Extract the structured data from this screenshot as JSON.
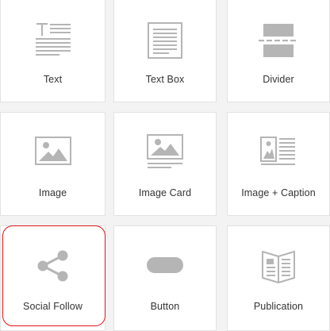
{
  "content_blocks": [
    {
      "label": "Text",
      "icon": "text-icon"
    },
    {
      "label": "Text Box",
      "icon": "text-box-icon"
    },
    {
      "label": "Divider",
      "icon": "divider-icon"
    },
    {
      "label": "Image",
      "icon": "image-icon"
    },
    {
      "label": "Image Card",
      "icon": "image-card-icon"
    },
    {
      "label": "Image + Caption",
      "icon": "image-caption-icon"
    },
    {
      "label": "Social Follow",
      "icon": "share-icon"
    },
    {
      "label": "Button",
      "icon": "button-icon"
    },
    {
      "label": "Publication",
      "icon": "publication-icon"
    }
  ],
  "highlighted_block": "Social Follow",
  "colors": {
    "icon_gray": "#b5b5b5",
    "highlight_red": "#e0161b",
    "tile_background": "#ffffff",
    "page_background": "#f3f3f3"
  }
}
